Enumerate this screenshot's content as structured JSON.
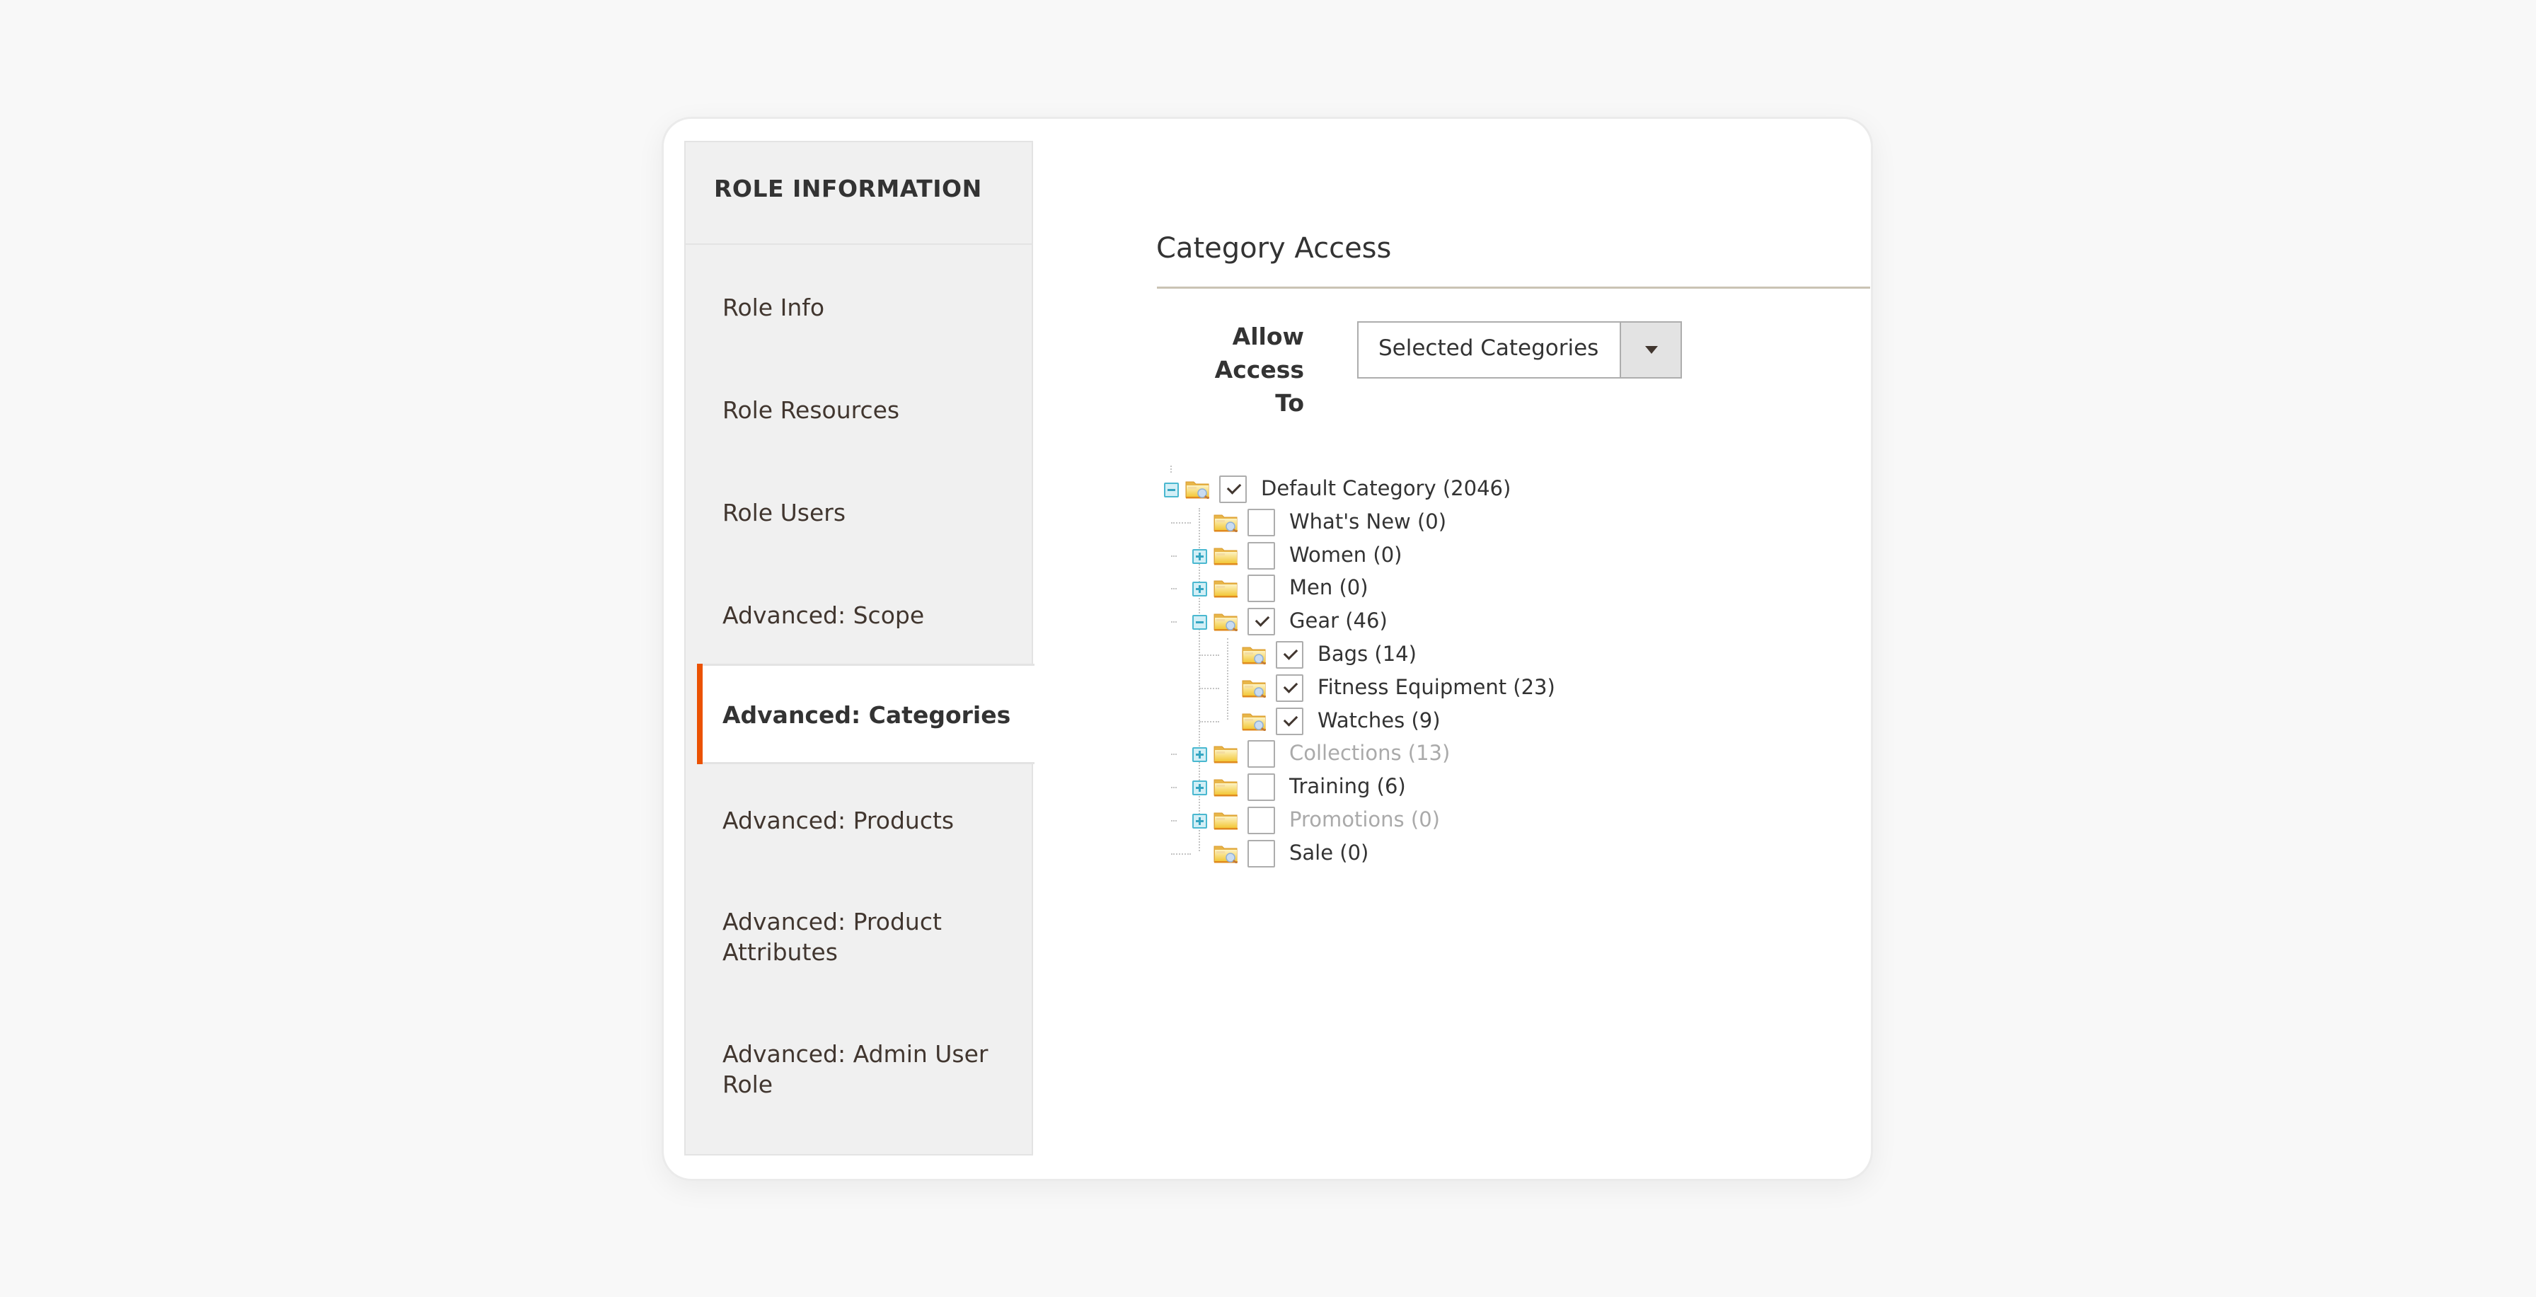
{
  "sidebar": {
    "header": "ROLE INFORMATION",
    "items": [
      {
        "label": "Role Info",
        "active": false
      },
      {
        "label": "Role Resources",
        "active": false
      },
      {
        "label": "Role Users",
        "active": false
      },
      {
        "label": "Advanced: Scope",
        "active": false
      },
      {
        "label": "Advanced: Categories",
        "active": true
      },
      {
        "label": "Advanced: Products",
        "active": false
      },
      {
        "label": "Advanced: Product Attributes",
        "active": false
      },
      {
        "label": "Advanced: Admin User Role",
        "active": false
      }
    ],
    "accent_color": "#eb5202"
  },
  "content": {
    "section_title": "Category Access",
    "allow_access": {
      "label": "Allow Access To",
      "selected": "Selected Categories"
    }
  },
  "tree": [
    {
      "label": "Default Category (2046)",
      "level": 0,
      "expander": "minus",
      "checked": true,
      "muted": false,
      "folder": "open-search"
    },
    {
      "label": "What's New (0)",
      "level": 1,
      "expander": null,
      "checked": false,
      "muted": false,
      "folder": "open-search"
    },
    {
      "label": "Women (0)",
      "level": 1,
      "expander": "plus",
      "checked": false,
      "muted": false,
      "folder": "closed"
    },
    {
      "label": "Men (0)",
      "level": 1,
      "expander": "plus",
      "checked": false,
      "muted": false,
      "folder": "closed"
    },
    {
      "label": "Gear (46)",
      "level": 1,
      "expander": "minus",
      "checked": true,
      "muted": false,
      "folder": "open-search"
    },
    {
      "label": "Bags (14)",
      "level": 2,
      "expander": null,
      "checked": true,
      "muted": false,
      "folder": "open-search"
    },
    {
      "label": "Fitness Equipment (23)",
      "level": 2,
      "expander": null,
      "checked": true,
      "muted": false,
      "folder": "open-search"
    },
    {
      "label": "Watches (9)",
      "level": 2,
      "expander": null,
      "checked": true,
      "muted": false,
      "folder": "open-search"
    },
    {
      "label": "Collections (13)",
      "level": 1,
      "expander": "plus",
      "checked": false,
      "muted": true,
      "folder": "closed"
    },
    {
      "label": "Training (6)",
      "level": 1,
      "expander": "plus",
      "checked": false,
      "muted": false,
      "folder": "closed"
    },
    {
      "label": "Promotions (0)",
      "level": 1,
      "expander": "plus",
      "checked": false,
      "muted": true,
      "folder": "closed"
    },
    {
      "label": "Sale (0)",
      "level": 1,
      "expander": null,
      "checked": false,
      "muted": false,
      "folder": "open-search"
    }
  ]
}
